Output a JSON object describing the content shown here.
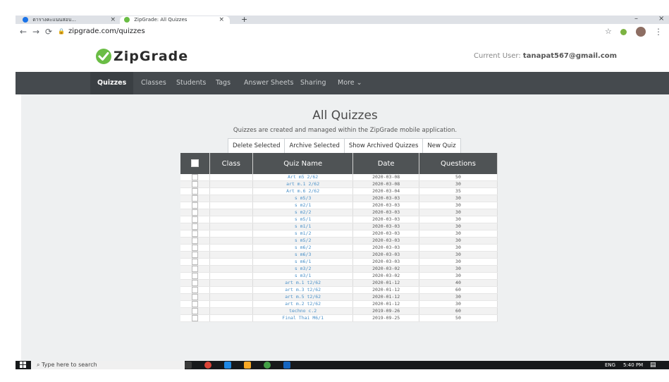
{
  "browser": {
    "tabs": [
      {
        "label": "ตารางคะแนนสอบ...",
        "active": false
      },
      {
        "label": "ZipGrade: All Quizzes",
        "active": true
      }
    ],
    "new_tab_glyph": "+",
    "url": "zipgrade.com/quizzes",
    "window_controls": [
      "–",
      "□",
      "×"
    ]
  },
  "header": {
    "logo_text": "ZipGrade",
    "current_user_label": "Current User:",
    "current_user_email": "tanapat567@gmail.com"
  },
  "nav": {
    "items": [
      "Quizzes",
      "Classes",
      "Students",
      "Tags",
      "Answer Sheets",
      "Sharing",
      "More ⌄"
    ],
    "active": "Quizzes"
  },
  "page": {
    "title": "All Quizzes",
    "subtitle": "Quizzes are created and managed within the ZipGrade mobile application.",
    "actions": [
      "Delete Selected",
      "Archive Selected",
      "Show Archived Quizzes",
      "New Quiz"
    ]
  },
  "table": {
    "columns": [
      "",
      "Class",
      "Quiz Name",
      "Date",
      "Questions"
    ],
    "rows": [
      {
        "class": "",
        "quiz": "Art m5 2/62",
        "date": "2020-03-08",
        "questions": "50"
      },
      {
        "class": "",
        "quiz": "art m.1 2/62",
        "date": "2020-03-08",
        "questions": "30"
      },
      {
        "class": "",
        "quiz": "Art m.6 2/62",
        "date": "2020-03-04",
        "questions": "35"
      },
      {
        "class": "",
        "quiz": "s m5/3",
        "date": "2020-03-03",
        "questions": "30"
      },
      {
        "class": "",
        "quiz": "s m2/1",
        "date": "2020-03-03",
        "questions": "30"
      },
      {
        "class": "",
        "quiz": "s m2/2",
        "date": "2020-03-03",
        "questions": "30"
      },
      {
        "class": "",
        "quiz": "s m5/1",
        "date": "2020-03-03",
        "questions": "30"
      },
      {
        "class": "",
        "quiz": "s m1/1",
        "date": "2020-03-03",
        "questions": "30"
      },
      {
        "class": "",
        "quiz": "s m1/2",
        "date": "2020-03-03",
        "questions": "30"
      },
      {
        "class": "",
        "quiz": "s m5/2",
        "date": "2020-03-03",
        "questions": "30"
      },
      {
        "class": "",
        "quiz": "s m6/2",
        "date": "2020-03-03",
        "questions": "30"
      },
      {
        "class": "",
        "quiz": "s m6/3",
        "date": "2020-03-03",
        "questions": "30"
      },
      {
        "class": "",
        "quiz": "s m6/1",
        "date": "2020-03-03",
        "questions": "30"
      },
      {
        "class": "",
        "quiz": "s m3/2",
        "date": "2020-03-02",
        "questions": "30"
      },
      {
        "class": "",
        "quiz": "s m3/1",
        "date": "2020-03-02",
        "questions": "30"
      },
      {
        "class": "",
        "quiz": "art m.1 t2/62",
        "date": "2020-01-12",
        "questions": "40"
      },
      {
        "class": "",
        "quiz": "art m.3 t2/62",
        "date": "2020-01-12",
        "questions": "60"
      },
      {
        "class": "",
        "quiz": "art m.5 t2/62",
        "date": "2020-01-12",
        "questions": "30"
      },
      {
        "class": "",
        "quiz": "art m.2 t2/62",
        "date": "2020-01-12",
        "questions": "30"
      },
      {
        "class": "",
        "quiz": "techno c.2",
        "date": "2019-09-26",
        "questions": "60"
      },
      {
        "class": "",
        "quiz": "Final Thai M6/1",
        "date": "2019-09-25",
        "questions": "50"
      }
    ]
  },
  "taskbar": {
    "search_placeholder": "Type here to search",
    "language": "ENG",
    "time": "5:40 PM"
  },
  "colors": {
    "nav_bg": "#454a4e",
    "table_header_bg": "#4f5355",
    "link_blue": "#4a90c8",
    "logo_green": "#6abd45",
    "content_bg": "#eef0f1"
  }
}
